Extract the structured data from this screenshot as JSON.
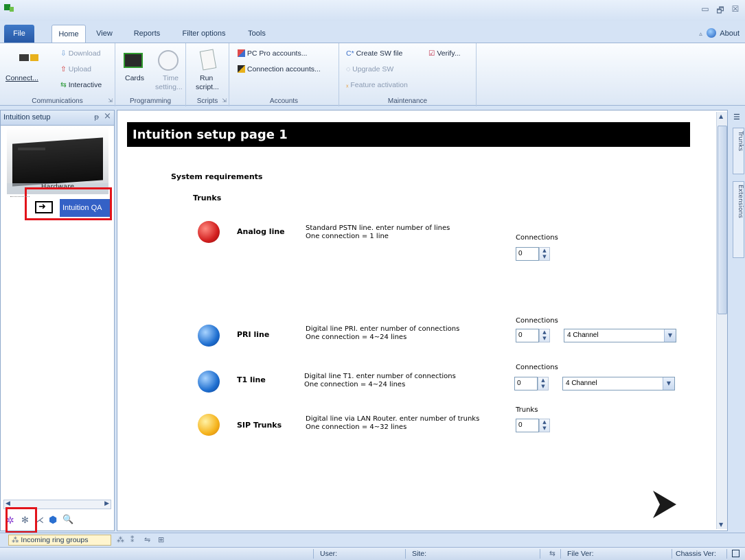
{
  "window": {
    "minimize": "▭",
    "restore": "🗗",
    "close": "☒"
  },
  "tabs": {
    "file": "File",
    "home": "Home",
    "view": "View",
    "reports": "Reports",
    "filter": "Filter options",
    "tools": "Tools"
  },
  "about": {
    "label": "About"
  },
  "ribbon": {
    "communications": {
      "caption": "Communications",
      "connect": "Connect...",
      "download": "Download",
      "upload": "Upload",
      "interactive": "Interactive"
    },
    "programming": {
      "caption": "Programming",
      "cards": "Cards",
      "time_line1": "Time",
      "time_line2": "setting..."
    },
    "scripts": {
      "caption": "Scripts",
      "run_line1": "Run",
      "run_line2": "script..."
    },
    "accounts": {
      "caption": "Accounts",
      "pcpro": "PC Pro accounts...",
      "connection": "Connection accounts..."
    },
    "maintenance": {
      "caption": "Maintenance",
      "create_sw": "Create SW file",
      "verify": "Verify...",
      "upgrade_sw": "Upgrade SW",
      "feature": "Feature activation"
    }
  },
  "leftpanel": {
    "title": "Intuition setup",
    "pin": "ᵽ",
    "close": "×",
    "hardware": "Hardware",
    "tree_item": "Intuition QA"
  },
  "content": {
    "page_title": "Intuition setup page 1",
    "system_requirements": "System requirements",
    "trunks_heading": "Trunks",
    "rows": [
      {
        "name": "Analog line",
        "desc1": "Standard PSTN line. enter number of lines",
        "desc2": "One connection = 1 line",
        "spin_label": "Connections",
        "value": "0"
      },
      {
        "name": "PRI line",
        "desc1": "Digital line PRI. enter number of connections",
        "desc2": "One connection = 4~24 lines",
        "spin_label": "Connections",
        "value": "0",
        "dropdown": "4 Channel"
      },
      {
        "name": "T1 line",
        "desc1": "Digital line T1. enter number of connections",
        "desc2": "One connection = 4~24 lines",
        "spin_label": "Connections",
        "value": "0",
        "dropdown": "4 Channel"
      },
      {
        "name": "SIP Trunks",
        "desc1": "Digital line via LAN Router. enter number of trunks",
        "desc2": "One connection = 4~32 lines",
        "spin_label": "Trunks",
        "value": "0"
      }
    ]
  },
  "rightbar": {
    "trunks": "Trunks",
    "extensions": "Extensions"
  },
  "bottombar": {
    "incoming": "Incoming ring groups"
  },
  "status": {
    "user": "User:",
    "site": "Site:",
    "file_ver": "File Ver:",
    "chassis_ver": "Chassis Ver:"
  },
  "colors": {
    "accent": "#3461c6",
    "highlight_box": "#e2141b",
    "title_bg": "#000000"
  }
}
